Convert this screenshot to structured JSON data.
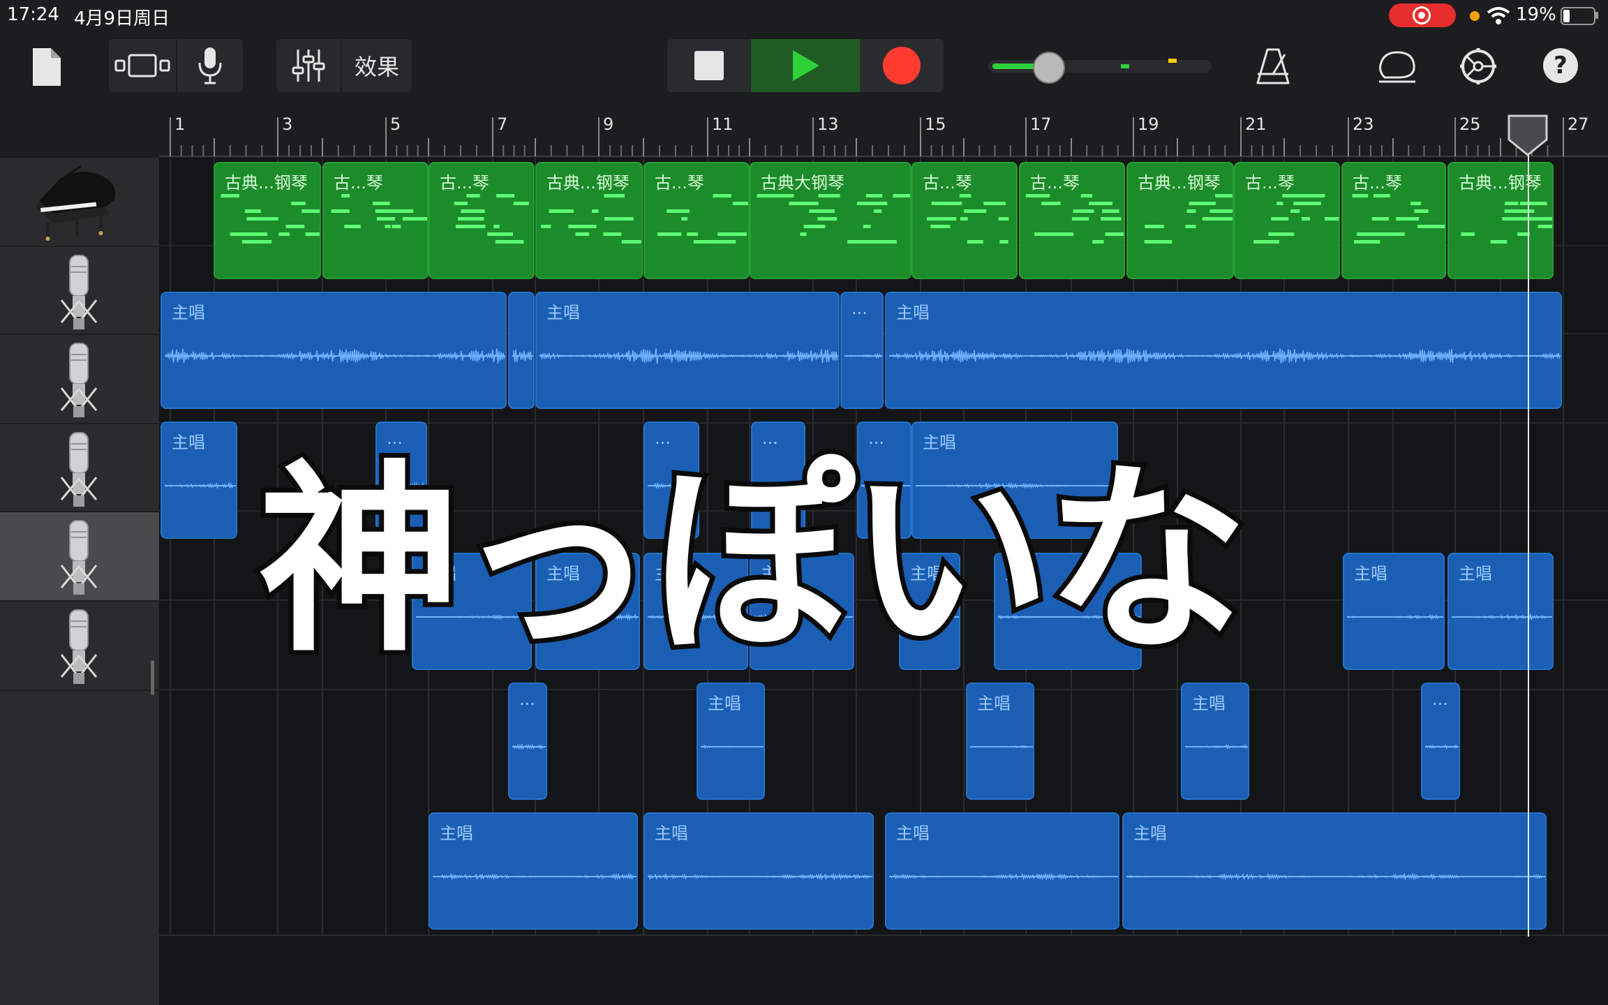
{
  "status_bar": {
    "time": "17:24",
    "date": "4月9日周日",
    "battery": "19%"
  },
  "toolbar": {
    "effects_label": "效果"
  },
  "ruler": {
    "labels": [
      "1",
      "3",
      "5",
      "7",
      "9",
      "11",
      "13",
      "15",
      "17",
      "19",
      "21",
      "23",
      "25",
      "27"
    ]
  },
  "tracks": [
    {
      "instrument": "grand-piano",
      "regions": [
        "古典...钢琴",
        "古...琴",
        "古...琴",
        "古典...钢琴",
        "古...琴",
        "古典大钢琴",
        "古...琴",
        "古...琴",
        "古典...钢琴",
        "古...琴",
        "古...琴",
        "古典...钢琴"
      ]
    },
    {
      "instrument": "microphone",
      "regions": [
        "主唱",
        "",
        "主唱",
        "...",
        "主唱"
      ]
    },
    {
      "instrument": "microphone",
      "regions": [
        "主唱",
        "...",
        "...",
        "...",
        "...",
        "主唱"
      ]
    },
    {
      "instrument": "microphone",
      "regions": [
        "主唱",
        "主唱",
        "主唱",
        "主唱",
        "主唱",
        "主唱",
        "主唱",
        "主唱"
      ]
    },
    {
      "instrument": "microphone",
      "regions": [
        "...",
        "主唱",
        "主唱",
        "主唱",
        "..."
      ]
    },
    {
      "instrument": "microphone",
      "regions": [
        "主唱",
        "主唱",
        "主唱",
        "主唱"
      ]
    }
  ],
  "overlay_caption": "神っぽいな",
  "colors": {
    "midi_region": "#1c8b2a",
    "audio_region": "#1a5fb4",
    "play": "#2fd13b",
    "record": "#ff3b30"
  }
}
